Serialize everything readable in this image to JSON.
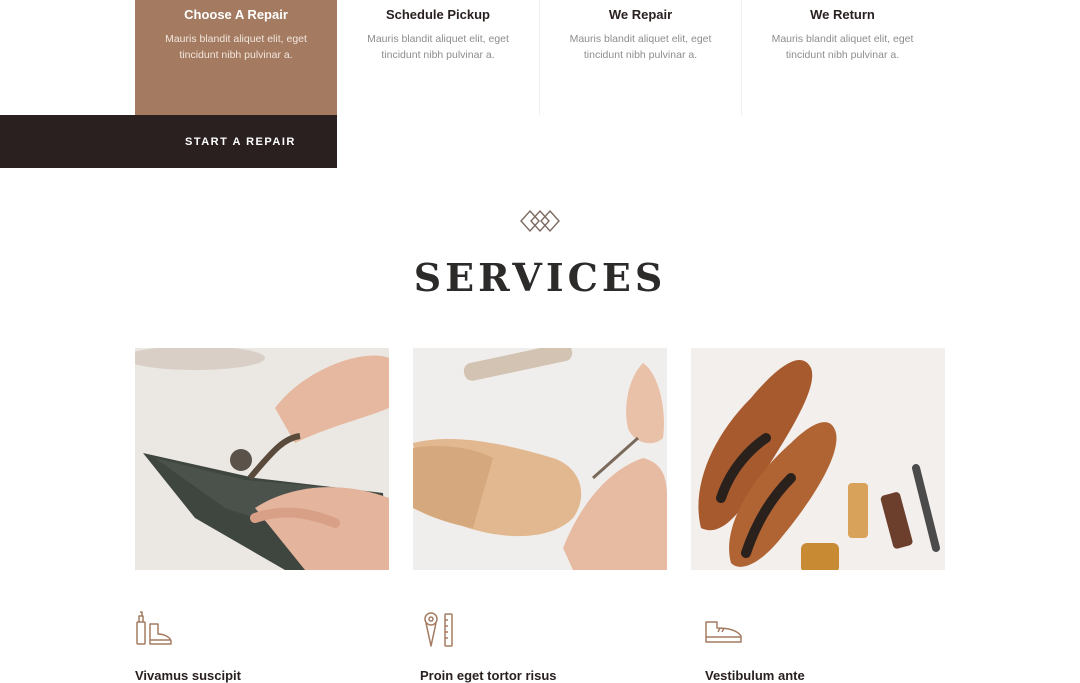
{
  "steps": [
    {
      "title": "Choose A Repair",
      "desc": "Mauris blandit aliquet elit, eget tincidunt nibh pulvinar a."
    },
    {
      "title": "Schedule Pickup",
      "desc": "Mauris blandit aliquet elit, eget tincidunt nibh pulvinar a."
    },
    {
      "title": "We Repair",
      "desc": "Mauris blandit aliquet elit, eget tincidunt nibh pulvinar a."
    },
    {
      "title": "We Return",
      "desc": "Mauris blandit aliquet elit, eget tincidunt nibh pulvinar a."
    }
  ],
  "cta": {
    "label": "START A REPAIR"
  },
  "section": {
    "title": "SERVICES"
  },
  "services": [
    {
      "title": "Vivamus suscipit",
      "image": "leather-cutting-photo",
      "icon": "boot-polish-icon"
    },
    {
      "title": "Proin eget tortor risus",
      "image": "shoe-last-photo",
      "icon": "sewing-tools-icon"
    },
    {
      "title": "Vestibulum ante",
      "image": "leather-shoes-photo",
      "icon": "shoe-icon"
    }
  ],
  "colors": {
    "accent": "#a47b61",
    "dark": "#2b2020",
    "text_muted": "#8d8d8d"
  }
}
